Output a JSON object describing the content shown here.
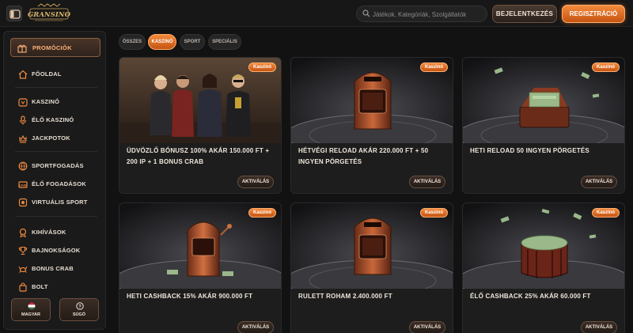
{
  "header": {
    "logo_text": "GRANSINO",
    "search_placeholder": "Játékok, Kategóriák, Szolgáltatók",
    "login_label": "BEJELENTKEZÉS",
    "register_label": "REGISZTRÁCIÓ"
  },
  "sidebar": {
    "promo_label": "PROMÓCIÓK",
    "items": [
      {
        "label": "FŐOLDAL",
        "icon": "home-icon"
      },
      {
        "label": "KASZINÓ",
        "icon": "casino-icon"
      },
      {
        "label": "ÉLŐ KASZINÓ",
        "icon": "live-casino-icon"
      },
      {
        "label": "JACKPOTOK",
        "icon": "jackpot-icon"
      },
      {
        "label": "SPORTFOGADÁS",
        "icon": "sports-ball-icon"
      },
      {
        "label": "ÉLŐ FOGADÁSOK",
        "icon": "live-bets-icon"
      },
      {
        "label": "VIRTUÁLIS SPORT",
        "icon": "virtual-sport-icon"
      },
      {
        "label": "KIHÍVÁSOK",
        "icon": "challenges-icon"
      },
      {
        "label": "BAJNOKSÁGOK",
        "icon": "trophy-icon"
      },
      {
        "label": "BONUS CRAB",
        "icon": "crab-icon"
      },
      {
        "label": "BOLT",
        "icon": "shop-icon"
      }
    ],
    "language_label": "MAGYAR",
    "help_label": "SÚGÓ"
  },
  "tabs": [
    {
      "label": "ÖSSZES",
      "active": false
    },
    {
      "label": "KASZINÓ",
      "active": true
    },
    {
      "label": "SPORT",
      "active": false
    },
    {
      "label": "SPECIÁLIS",
      "active": false
    }
  ],
  "cards": [
    {
      "badge": "Kaszinó",
      "title": "ÜDVÖZLŐ BÓNUSZ 100% AKÁR 150.000 FT + 200 IP + 1 BONUS CRAB",
      "button": "AKTIVÁLÁS",
      "image": "characters"
    },
    {
      "badge": "Kaszinó",
      "title": "HÉTVÉGI RELOAD AKÁR 220.000 FT + 50 INGYEN PÖRGETÉS",
      "button": "AKTIVÁLÁS",
      "image": "slot-machine"
    },
    {
      "badge": "Kaszinó",
      "title": "HETI RELOAD 50 INGYEN PÖRGETÉS",
      "button": "AKTIVÁLÁS",
      "image": "money-chest"
    },
    {
      "badge": "Kaszinó",
      "title": "HETI CASHBACK 15% AKÁR 900.000 FT",
      "button": "AKTIVÁLÁS",
      "image": "slot-machine-side"
    },
    {
      "badge": "Kaszinó",
      "title": "RULETT ROHAM 2.400.000 FT",
      "button": "AKTIVÁLÁS",
      "image": "slot-machine"
    },
    {
      "badge": "Kaszinó",
      "title": "ÉLŐ CASHBACK 25% AKÁR 60.000 FT",
      "button": "AKTIVÁLÁS",
      "image": "money-barrel"
    }
  ],
  "colors": {
    "accent": "#e8742a",
    "background": "#121212",
    "panel": "#1a1a1a"
  }
}
